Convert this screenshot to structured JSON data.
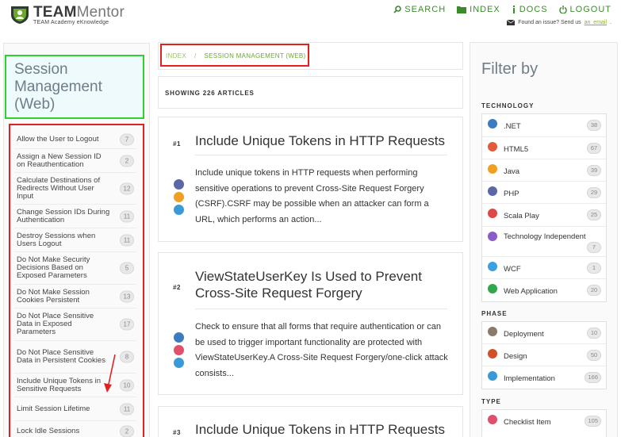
{
  "header": {
    "brand_bold": "TEAM",
    "brand_light": "Mentor",
    "brand_sub": "TEAM Academy eKnowledge",
    "nav": [
      {
        "label": "SEARCH",
        "icon": "search-icon"
      },
      {
        "label": "INDEX",
        "icon": "folder-icon"
      },
      {
        "label": "DOCS",
        "icon": "info-icon"
      },
      {
        "label": "LOGOUT",
        "icon": "power-icon"
      }
    ],
    "issue_text": "Found an issue? Send us",
    "issue_link": "an_email",
    "issue_end": "."
  },
  "sidebar": {
    "title": "Session Management (Web)",
    "items": [
      {
        "label": "Allow the User to Logout",
        "count": "7"
      },
      {
        "label": "Assign a New Session ID on Reauthentication",
        "count": "2"
      },
      {
        "label": "Calculate Destinations of Redirects Without User Input",
        "count": "12"
      },
      {
        "label": "Change Session IDs During Authentication",
        "count": "11"
      },
      {
        "label": "Destroy Sessions when Users Logout",
        "count": "11"
      },
      {
        "label": "Do Not Make Security Decisions Based on Exposed Parameters",
        "count": "5"
      },
      {
        "label": "Do Not Make Session Cookies Persistent",
        "count": "13"
      },
      {
        "label": "Do Not Place Sensitive Data in Exposed Parameters",
        "count": "17"
      },
      {
        "label": "Do Not Place Sensitive Data in Persistent Cookies",
        "count": "8"
      },
      {
        "label": "Include Unique Tokens in Sensitive Requests",
        "count": "10"
      },
      {
        "label": "Limit Session Lifetime",
        "count": "11"
      },
      {
        "label": "Lock Idle Sessions",
        "count": "2"
      }
    ]
  },
  "breadcrumb": {
    "root": "INDEX",
    "sep": "/",
    "current": "SESSION MANAGEMENT (WEB)"
  },
  "showing": "SHOWING 226 ARTICLES",
  "articles": [
    {
      "num": "#1",
      "title": "Include Unique Tokens in HTTP Requests",
      "desc": "Include unique tokens in HTTP requests when performing sensitive operations to prevent Cross-Site Request Forgery (CSRF).CSRF may be possible when an attacker can form a URL, which performs an action..."
    },
    {
      "num": "#2",
      "title": "ViewStateUserKey Is Used to Prevent Cross-Site Request Forgery",
      "desc": "Check to ensure that all forms that require authentication or can be used to trigger important functionality are protected with ViewStateUserKey.A Cross-Site Request Forgery/one-click attack consists..."
    },
    {
      "num": "#3",
      "title": "Include Unique Tokens in HTTP Requests",
      "desc": ""
    }
  ],
  "filter": {
    "title": "Filter by",
    "technology_label": "TECHNOLOGY",
    "technology": [
      {
        "name": ".NET",
        "count": "38",
        "color": "#3b7bbf"
      },
      {
        "name": "HTML5",
        "count": "67",
        "color": "#e25c3c"
      },
      {
        "name": "Java",
        "count": "39",
        "color": "#f0a020"
      },
      {
        "name": "PHP",
        "count": "29",
        "color": "#5a68a8"
      },
      {
        "name": "Scala Play",
        "count": "25",
        "color": "#e04848"
      },
      {
        "name": "Technology Independent",
        "count": "7",
        "color": "#8a5cc8"
      },
      {
        "name": "WCF",
        "count": "1",
        "color": "#3aa0e0"
      },
      {
        "name": "Web Application",
        "count": "20",
        "color": "#2ea84a"
      }
    ],
    "phase_label": "PHASE",
    "phase": [
      {
        "name": "Deployment",
        "count": "10",
        "color": "#8a7a6a"
      },
      {
        "name": "Design",
        "count": "50",
        "color": "#d0502a"
      },
      {
        "name": "Implementation",
        "count": "166",
        "color": "#3a9ad8"
      }
    ],
    "type_label": "TYPE",
    "type": [
      {
        "name": "Checklist Item",
        "count": "105",
        "color": "#e0506a"
      }
    ]
  }
}
